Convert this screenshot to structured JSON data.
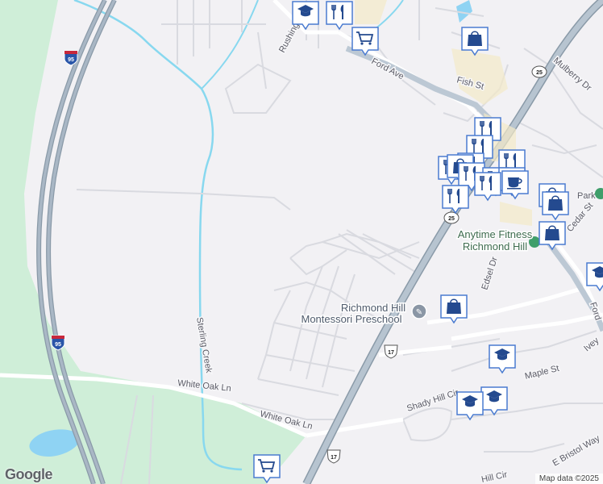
{
  "map": {
    "brand": "Google",
    "attribution": "Map data ©2025"
  },
  "labels": {
    "rushing": "Rushing",
    "ford_ave": "Ford Ave",
    "fish_st": "Fish St",
    "mulberry": "Mulberry Dr",
    "park": "Park",
    "cedar": "Cedar St",
    "edsel": "Edsel Dr",
    "ford": "Ford",
    "sterling_creek": "Sterling Creek",
    "white_oak_1": "White Oak Ln",
    "white_oak_2": "White Oak Ln",
    "shady_hill": "Shady Hill Cir",
    "maple": "Maple St",
    "ivey": "Ivey",
    "bristol": "E Bristol Way",
    "hill_cir": "Hill Cir"
  },
  "shields": {
    "i95_top": "95",
    "i95_bottom": "95",
    "us17_a": "17",
    "us17_b": "17",
    "sr25_a": "25",
    "sr25_b": "25"
  },
  "places": {
    "gym": "Anytime Fitness Richmond Hill",
    "gym_line1": "Anytime Fitness",
    "gym_line2": "Richmond Hill",
    "school_line1": "Richmond Hill",
    "school_line2": "Montessori Preschool"
  }
}
